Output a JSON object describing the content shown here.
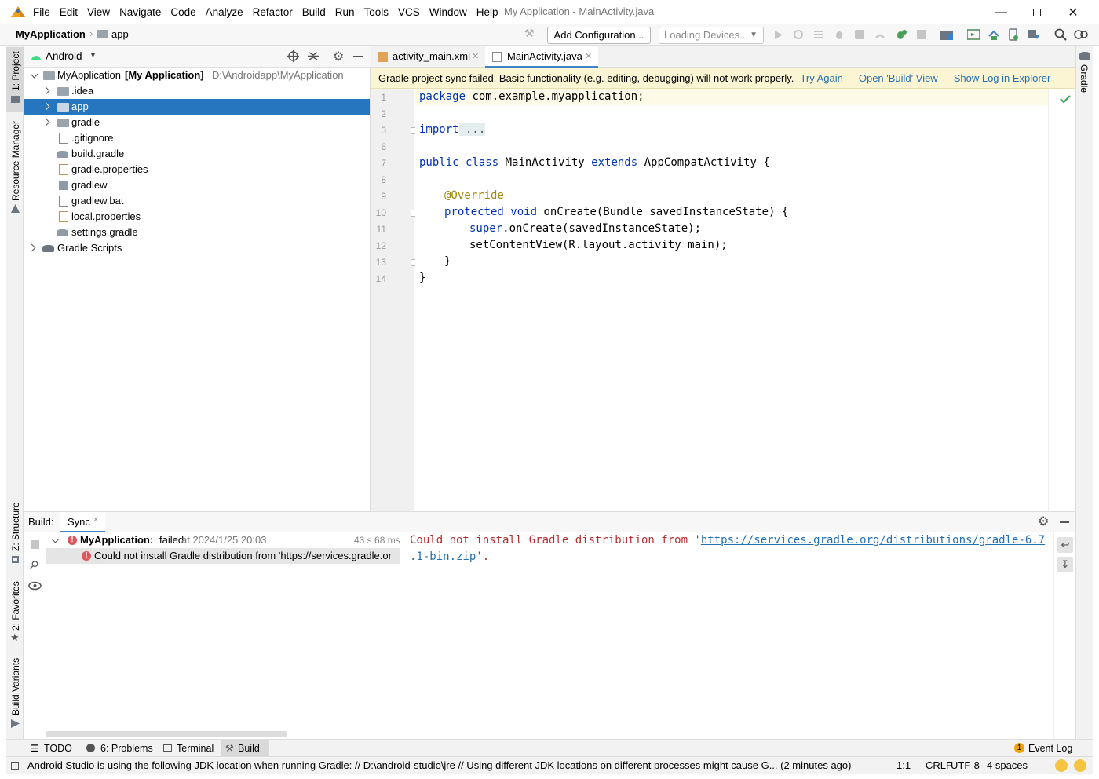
{
  "menu": [
    "File",
    "Edit",
    "View",
    "Navigate",
    "Code",
    "Analyze",
    "Refactor",
    "Build",
    "Run",
    "Tools",
    "VCS",
    "Window",
    "Help"
  ],
  "window_title": "My Application - MainActivity.java",
  "nav": {
    "project": "MyApplication",
    "module": "app",
    "add_config": "Add Configuration...",
    "devices": "Loading Devices..."
  },
  "left_stripe": {
    "project": "1: Project",
    "resource": "Resource Manager",
    "structure": "Z: Structure",
    "favorites": "2: Favorites",
    "variants": "Build Variants"
  },
  "right_stripe": {
    "gradle": "Gradle"
  },
  "project_panel": {
    "view": "Android",
    "root_name": "MyApplication",
    "root_bold": "[My Application]",
    "root_path": "D:\\Androidapp\\MyApplication",
    "items": [
      ".idea",
      "app",
      "gradle",
      ".gitignore",
      "build.gradle",
      "gradle.properties",
      "gradlew",
      "gradlew.bat",
      "local.properties",
      "settings.gradle"
    ],
    "scripts": "Gradle Scripts"
  },
  "tabs": [
    "activity_main.xml",
    "MainActivity.java"
  ],
  "banner": {
    "message": "Gradle project sync failed. Basic functionality (e.g. editing, debugging) will not work properly.",
    "try_again": "Try Again",
    "open_build": "Open 'Build' View",
    "show_log": "Show Log in Explorer"
  },
  "line_numbers": [
    "1",
    "2",
    "3",
    "6",
    "7",
    "8",
    "9",
    "10",
    "11",
    "12",
    "13",
    "14"
  ],
  "code": {
    "l1_kw": "package",
    "l1_rest": " com.example.myapplication;",
    "l3_kw": "import",
    "l3_rest": " ...",
    "l7_kw1": "public",
    "l7_kw2": " class",
    "l7_mid": " MainActivity",
    "l7_kw3": " extends",
    "l7_rest": " AppCompatActivity {",
    "l9": "@Override",
    "l10_kw1": "protected",
    "l10_kw2": " void",
    "l10_rest": " onCreate(Bundle savedInstanceState) {",
    "l11_kw": "super",
    "l11_rest": ".onCreate(savedInstanceState);",
    "l12": "setContentView(R.layout.activity_main);",
    "l13": "}",
    "l14": "}"
  },
  "build": {
    "label": "Build:",
    "tab": "Sync",
    "root_name": "MyApplication:",
    "root_status": " failed",
    "root_time": " at 2024/1/25 20:03",
    "duration": "43 s 68 ms",
    "error_item": "Could not install Gradle distribution from 'https://services.gradle.or",
    "out_text": "Could not install Gradle distribution from '",
    "out_link1": "https://services.gradle.org/distributions/gradle-6.7",
    "out_link2": ".1-bin.zip",
    "out_tail": "'."
  },
  "bottom_tabs": {
    "todo": "TODO",
    "problems": "6: Problems",
    "terminal": "Terminal",
    "build": "Build",
    "event_log": "Event Log",
    "event_count": "1"
  },
  "status": {
    "message": "Android Studio is using the following JDK location when running Gradle: // D:\\android-studio\\jre // Using different JDK locations on different processes might cause G... (2 minutes ago)",
    "pos": "1:1",
    "eol": "CRLF",
    "enc": "UTF-8",
    "indent": "4 spaces"
  },
  "colors": {
    "accent": "#2675bf",
    "banner": "#fcf5d4",
    "error": "#db5860",
    "link": "#2470b3",
    "keyword": "#0033b3"
  }
}
